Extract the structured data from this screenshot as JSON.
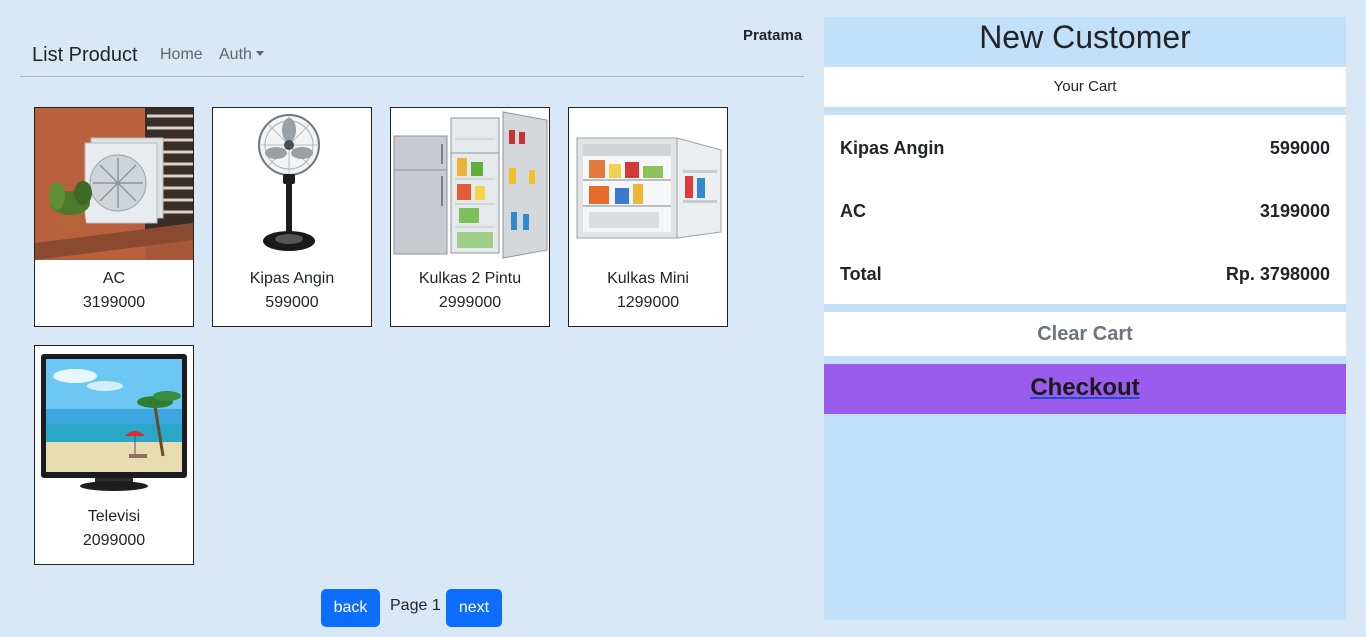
{
  "header": {
    "user_name": "Pratama"
  },
  "navbar": {
    "brand": "List Product",
    "home": "Home",
    "auth": "Auth"
  },
  "products": [
    {
      "name": "AC",
      "price": "3199000",
      "icon": "air-conditioner-image"
    },
    {
      "name": "Kipas Angin",
      "price": "599000",
      "icon": "fan-image"
    },
    {
      "name": "Kulkas 2 Pintu",
      "price": "2999000",
      "icon": "refrigerator-two-door-image"
    },
    {
      "name": "Kulkas Mini",
      "price": "1299000",
      "icon": "mini-fridge-image"
    },
    {
      "name": "Televisi",
      "price": "2099000",
      "icon": "television-image"
    }
  ],
  "pagination": {
    "back": "back",
    "page": "Page 1",
    "next": "next"
  },
  "cart": {
    "customer": "New Customer",
    "title": "Your Cart",
    "items": [
      {
        "name": "Kipas Angin",
        "price": "599000"
      },
      {
        "name": "AC",
        "price": "3199000"
      }
    ],
    "total_label": "Total",
    "total_value": "Rp. 3798000",
    "clear_label": "Clear Cart",
    "checkout_label": "Checkout"
  },
  "colors": {
    "background": "#d8e8f7",
    "panel": "#c2e0f8",
    "primary": "#0d6efd",
    "checkout": "#9a5ced"
  }
}
